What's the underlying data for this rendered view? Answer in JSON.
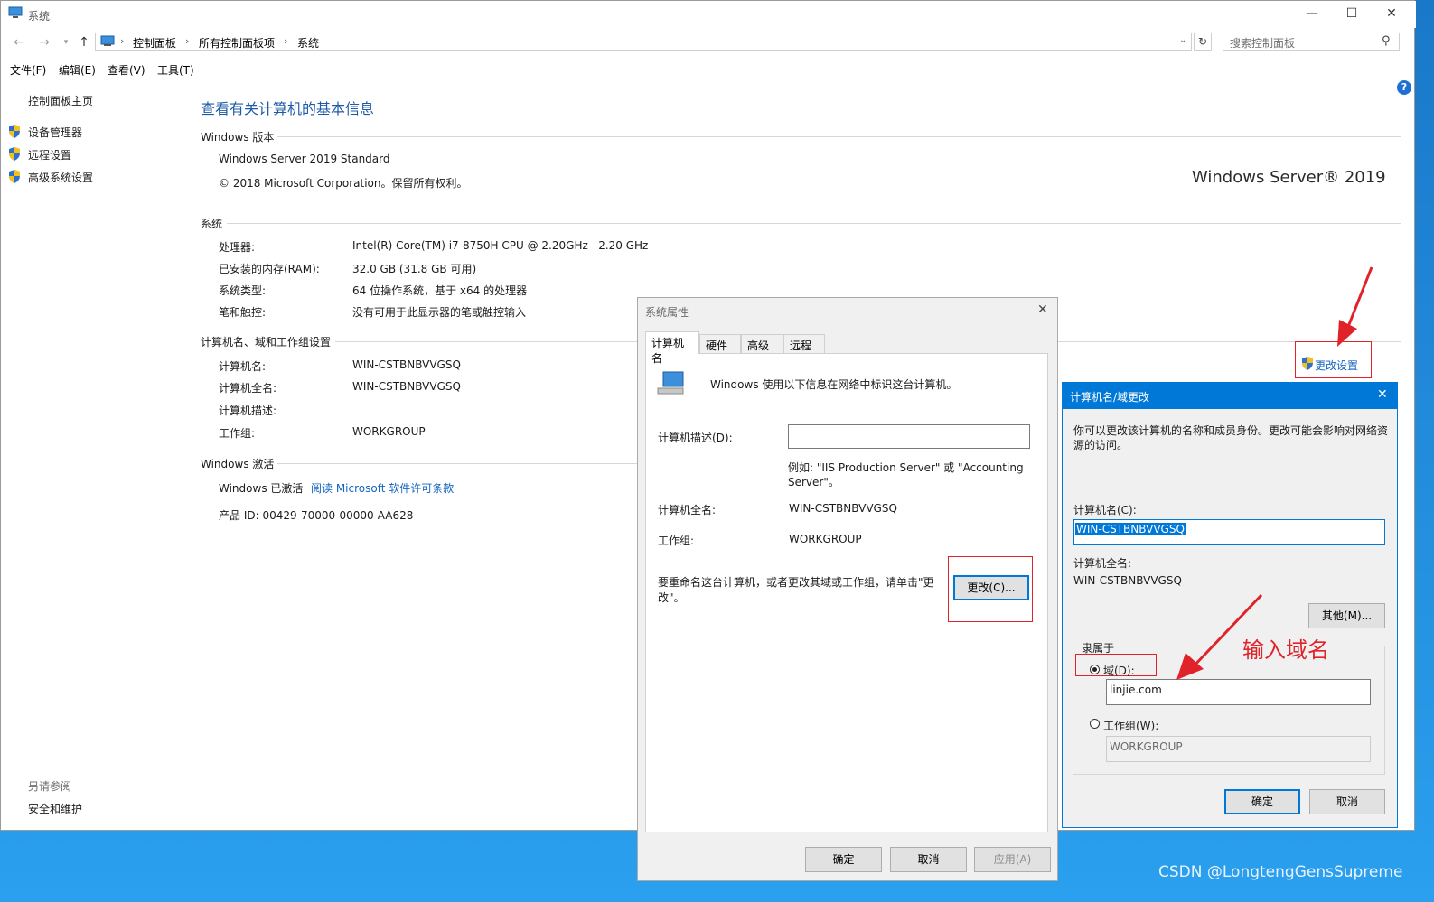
{
  "window": {
    "title": "系统",
    "min": "—",
    "max": "☐",
    "close": "✕"
  },
  "addressbar": {
    "crumbs": [
      "控制面板",
      "所有控制面板项",
      "系统"
    ],
    "search_placeholder": "搜索控制面板"
  },
  "menu": [
    "文件(F)",
    "编辑(E)",
    "查看(V)",
    "工具(T)"
  ],
  "sidebar": {
    "home": "控制面板主页",
    "items": [
      "设备管理器",
      "远程设置",
      "高级系统设置"
    ],
    "see_also_header": "另请参阅",
    "see_also": [
      "安全和维护"
    ]
  },
  "main": {
    "heading": "查看有关计算机的基本信息",
    "windows_edition_header": "Windows 版本",
    "edition": "Windows Server 2019 Standard",
    "copyright": "© 2018 Microsoft Corporation。保留所有权利。",
    "logo_text": "Windows Server® 2019",
    "system_header": "系统",
    "system_rows": [
      {
        "label": "处理器:",
        "value": "Intel(R) Core(TM) i7-8750H CPU @ 2.20GHz   2.20 GHz"
      },
      {
        "label": "已安装的内存(RAM):",
        "value": "32.0 GB (31.8 GB 可用)"
      },
      {
        "label": "系统类型:",
        "value": "64 位操作系统，基于 x64 的处理器"
      },
      {
        "label": "笔和触控:",
        "value": "没有可用于此显示器的笔或触控输入"
      }
    ],
    "name_header": "计算机名、域和工作组设置",
    "name_rows": [
      {
        "label": "计算机名:",
        "value": "WIN-CSTBNBVVGSQ"
      },
      {
        "label": "计算机全名:",
        "value": "WIN-CSTBNBVVGSQ"
      },
      {
        "label": "计算机描述:",
        "value": ""
      },
      {
        "label": "工作组:",
        "value": "WORKGROUP"
      }
    ],
    "change_settings": "更改设置",
    "activation_header": "Windows 激活",
    "activated": "Windows 已激活",
    "license_link": "阅读 Microsoft 软件许可条款",
    "product_id": "产品 ID: 00429-70000-00000-AA628"
  },
  "sysprops": {
    "title": "系统属性",
    "tabs": [
      "计算机名",
      "硬件",
      "高级",
      "远程"
    ],
    "intro": "Windows 使用以下信息在网络中标识这台计算机。",
    "desc_label": "计算机描述(D):",
    "desc_value": "",
    "example": "例如: \"IIS Production Server\" 或 \"Accounting Server\"。",
    "fullname_label": "计算机全名:",
    "fullname_value": "WIN-CSTBNBVVGSQ",
    "workgroup_label": "工作组:",
    "workgroup_value": "WORKGROUP",
    "rename_text": "要重命名这台计算机，或者更改其域或工作组，请单击\"更改\"。",
    "change_button": "更改(C)...",
    "ok": "确定",
    "cancel": "取消",
    "apply": "应用(A)"
  },
  "namechange": {
    "title": "计算机名/域更改",
    "intro": "你可以更改该计算机的名称和成员身份。更改可能会影响对网络资源的访问。",
    "name_label": "计算机名(C):",
    "name_value": "WIN-CSTBNBVVGSQ",
    "fullname_label": "计算机全名:",
    "fullname_value": "WIN-CSTBNBVVGSQ",
    "more_button": "其他(M)...",
    "member_of": "隶属于",
    "domain_label": "域(D):",
    "domain_value": "linjie.com",
    "workgroup_label": "工作组(W):",
    "workgroup_value": "WORKGROUP",
    "ok": "确定",
    "cancel": "取消"
  },
  "annotation": "输入域名",
  "watermark": "CSDN @LongtengGensSupreme",
  "colors": {
    "accent": "#0078d7",
    "link": "#1565c0",
    "annotation": "#e0232a"
  }
}
